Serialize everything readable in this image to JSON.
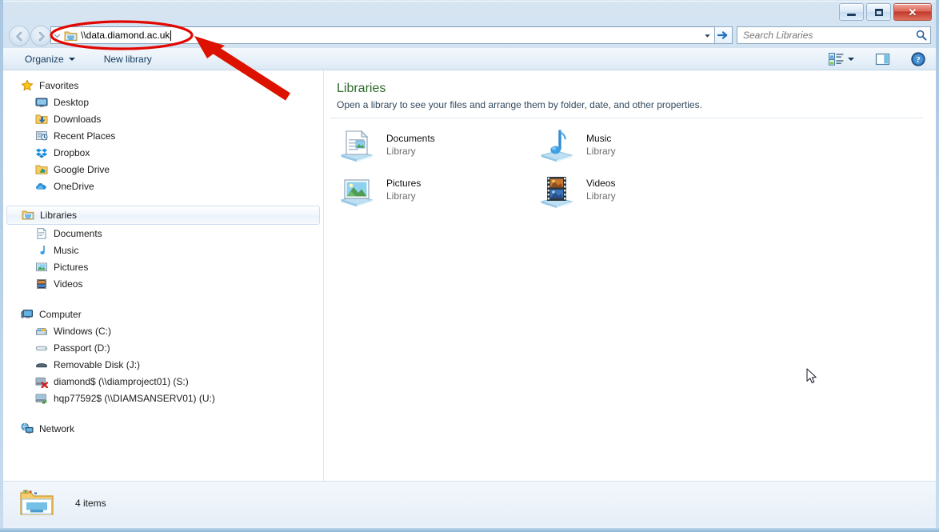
{
  "window": {
    "titlebar_buttons": [
      {
        "name": "minimize",
        "glyph": "–"
      },
      {
        "name": "maximize",
        "glyph": "□"
      },
      {
        "name": "close",
        "glyph": "✕"
      }
    ]
  },
  "address_bar": {
    "path_value": "\\\\data.diamond.ac.uk",
    "icon": "network-folder-icon",
    "back_icon": "back-arrow-icon",
    "forward_icon": "forward-arrow-icon",
    "previous_locations_icon": "chevron-down-icon",
    "go_icon": "go-arrow-icon",
    "dropdown_icon": "chevron-down-icon"
  },
  "search": {
    "placeholder": "Search Libraries",
    "icon": "search-icon"
  },
  "toolbar": {
    "organize_label": "Organize",
    "new_library_label": "New library",
    "view_icon": "change-view-icon",
    "view_dropdown_icon": "chevron-down-icon",
    "preview_pane_icon": "preview-pane-icon",
    "help_icon": "help-icon"
  },
  "sidebar": {
    "groups": [
      {
        "header": {
          "label": "Favorites",
          "icon": "star-icon"
        },
        "items": [
          {
            "label": "Desktop",
            "icon": "desktop-icon"
          },
          {
            "label": "Downloads",
            "icon": "downloads-folder-icon"
          },
          {
            "label": "Recent Places",
            "icon": "recent-places-icon"
          },
          {
            "label": "Dropbox",
            "icon": "dropbox-icon"
          },
          {
            "label": "Google Drive",
            "icon": "google-drive-icon"
          },
          {
            "label": "OneDrive",
            "icon": "onedrive-cloud-icon"
          }
        ]
      },
      {
        "header": {
          "label": "Libraries",
          "icon": "libraries-icon",
          "selected": true
        },
        "items": [
          {
            "label": "Documents",
            "icon": "documents-library-icon"
          },
          {
            "label": "Music",
            "icon": "music-library-icon"
          },
          {
            "label": "Pictures",
            "icon": "pictures-library-icon"
          },
          {
            "label": "Videos",
            "icon": "videos-library-icon"
          }
        ]
      },
      {
        "header": {
          "label": "Computer",
          "icon": "computer-icon"
        },
        "items": [
          {
            "label": "Windows (C:)",
            "icon": "system-drive-icon"
          },
          {
            "label": "Passport (D:)",
            "icon": "external-drive-icon"
          },
          {
            "label": "Removable Disk (J:)",
            "icon": "removable-disk-icon"
          },
          {
            "label": "diamond$ (\\\\diamproject01) (S:)",
            "icon": "disconnected-network-drive-icon"
          },
          {
            "label": "hqp77592$ (\\\\DIAMSANSERV01) (U:)",
            "icon": "network-drive-icon"
          }
        ]
      },
      {
        "header": {
          "label": "Network",
          "icon": "network-icon"
        },
        "items": []
      }
    ]
  },
  "main": {
    "title": "Libraries",
    "subtitle": "Open a library to see your files and arrange them by folder, date, and other properties.",
    "libraries": [
      {
        "name": "Documents",
        "kind": "Library",
        "icon": "documents-library-icon"
      },
      {
        "name": "Music",
        "kind": "Library",
        "icon": "music-library-icon"
      },
      {
        "name": "Pictures",
        "kind": "Library",
        "icon": "pictures-library-icon"
      },
      {
        "name": "Videos",
        "kind": "Library",
        "icon": "videos-library-icon"
      }
    ]
  },
  "status_bar": {
    "item_count": "4 items",
    "icon": "libraries-folder-icon"
  },
  "annotations": {
    "ellipse_color": "#e10600",
    "arrow_color": "#dd1100",
    "ellipse_target": "address-bar-path",
    "arrow_points_to": "address-bar-path"
  },
  "colors": {
    "accent": "#2d6b2d",
    "frame": "#cfe0f0",
    "annotation_red": "#e10600"
  }
}
